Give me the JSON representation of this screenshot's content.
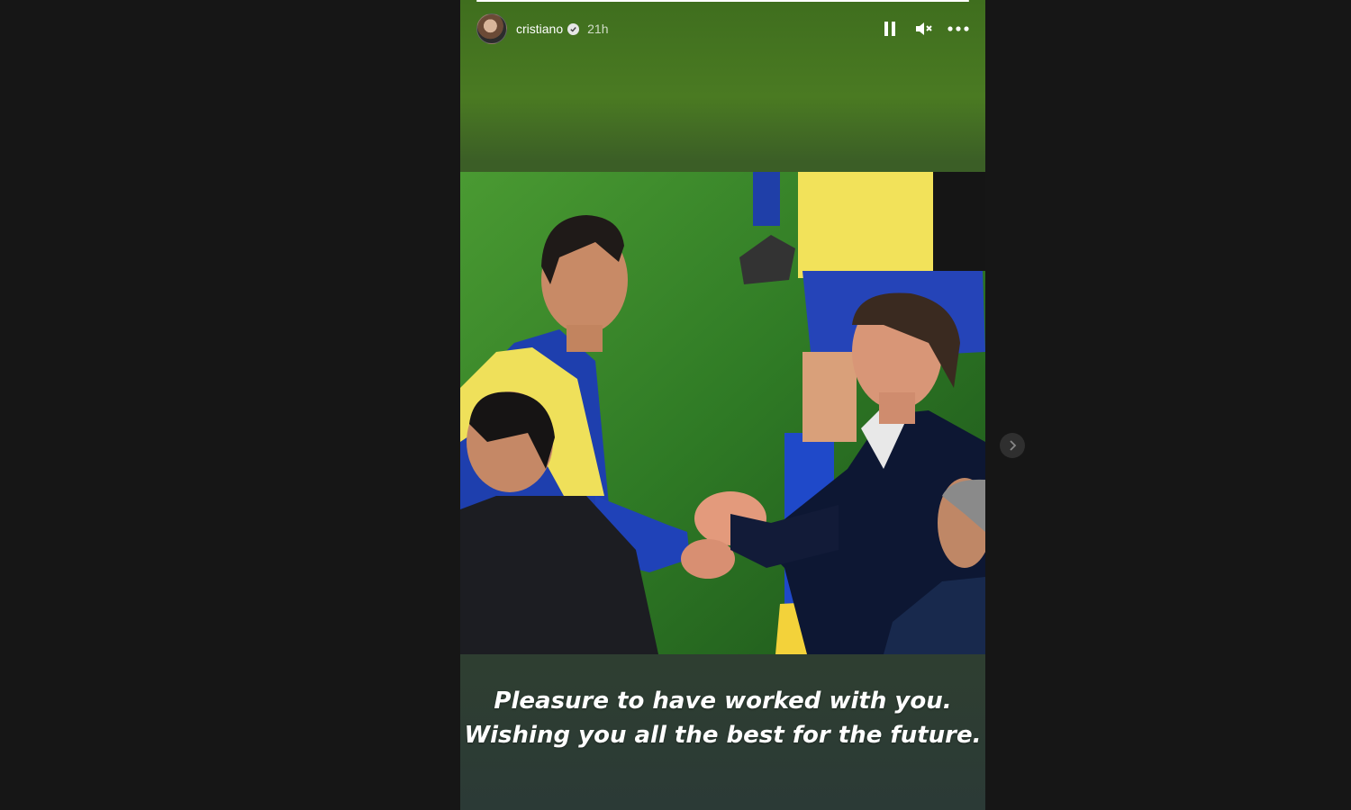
{
  "story": {
    "username": "cristiano",
    "verified": true,
    "time": "21h",
    "progress": 1.0,
    "caption": "Pleasure to have worked with you.\nWishing you all the best for the future."
  },
  "controls": {
    "pause_icon": "pause-icon",
    "mute_icon": "speaker-muted-icon",
    "more_icon": "more-options-icon"
  },
  "nav": {
    "next_icon": "chevron-right-icon"
  },
  "colors": {
    "background": "#161616",
    "story_top": "#4a7a22",
    "story_bottom": "#2b3a36",
    "text": "#ffffff"
  }
}
